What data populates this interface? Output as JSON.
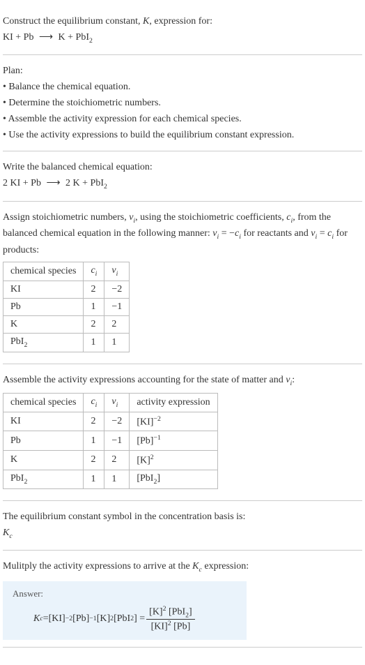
{
  "intro": {
    "prompt": "Construct the equilibrium constant, ",
    "K": "K",
    "prompt2": ", expression for:",
    "reaction_lhs": "KI + Pb",
    "arrow": "⟶",
    "reaction_rhs_K": "K + PbI",
    "reaction_rhs_sub": "2"
  },
  "plan": {
    "title": "Plan:",
    "b1": "• Balance the chemical equation.",
    "b2": "• Determine the stoichiometric numbers.",
    "b3": "• Assemble the activity expression for each chemical species.",
    "b4": "• Use the activity expressions to build the equilibrium constant expression."
  },
  "balanced": {
    "title": "Write the balanced chemical equation:",
    "lhs": "2 KI + Pb",
    "arrow": "⟶",
    "rhs_a": "2 K + PbI",
    "rhs_sub": "2"
  },
  "stoich": {
    "intro_a": "Assign stoichiometric numbers, ",
    "nu": "ν",
    "sub_i": "i",
    "intro_b": ", using the stoichiometric coefficients, ",
    "c": "c",
    "intro_c": ", from the balanced chemical equation in the following manner: ",
    "rel1_a": "ν",
    "rel1_b": " = −",
    "rel1_c": "c",
    "rel1_d": " for reactants and ",
    "rel2_a": "ν",
    "rel2_b": " = ",
    "rel2_c": "c",
    "rel2_d": " for products:",
    "h1": "chemical species",
    "h2": "c",
    "h3": "ν",
    "rows": [
      {
        "sp": "KI",
        "c": "2",
        "n": "−2"
      },
      {
        "sp": "Pb",
        "c": "1",
        "n": "−1"
      },
      {
        "sp": "K",
        "c": "2",
        "n": "2"
      },
      {
        "sp_a": "PbI",
        "sp_sub": "2",
        "c": "1",
        "n": "1"
      }
    ]
  },
  "activity": {
    "intro_a": "Assemble the activity expressions accounting for the state of matter and ",
    "nu": "ν",
    "sub_i": "i",
    "intro_b": ":",
    "h1": "chemical species",
    "h2": "c",
    "h3": "ν",
    "h4": "activity expression",
    "rows": [
      {
        "sp": "KI",
        "c": "2",
        "n": "−2",
        "ae_a": "[KI]",
        "ae_sup": "−2"
      },
      {
        "sp": "Pb",
        "c": "1",
        "n": "−1",
        "ae_a": "[Pb]",
        "ae_sup": "−1"
      },
      {
        "sp": "K",
        "c": "2",
        "n": "2",
        "ae_a": "[K]",
        "ae_sup": "2"
      },
      {
        "sp_a": "PbI",
        "sp_sub": "2",
        "c": "1",
        "n": "1",
        "ae_a": "[PbI",
        "ae_sub": "2",
        "ae_b": "]"
      }
    ]
  },
  "symbol": {
    "intro": "The equilibrium constant symbol in the concentration basis is:",
    "K": "K",
    "sub": "c"
  },
  "final": {
    "intro_a": "Mulitply the activity expressions to arrive at the ",
    "K": "K",
    "sub": "c",
    "intro_b": " expression:",
    "answer": "Answer:",
    "Kc": "K",
    "Kc_sub": "c",
    "eq": " = ",
    "t1": "[KI]",
    "t1s": "−2",
    "t2": " [Pb]",
    "t2s": "−1",
    "t3": " [K]",
    "t3s": "2",
    "t4": " [PbI",
    "t4sub": "2",
    "t4b": "] = ",
    "num_a": "[K]",
    "num_as": "2",
    "num_b": " [PbI",
    "num_bsub": "2",
    "num_c": "]",
    "den_a": "[KI]",
    "den_as": "2",
    "den_b": " [Pb]"
  }
}
